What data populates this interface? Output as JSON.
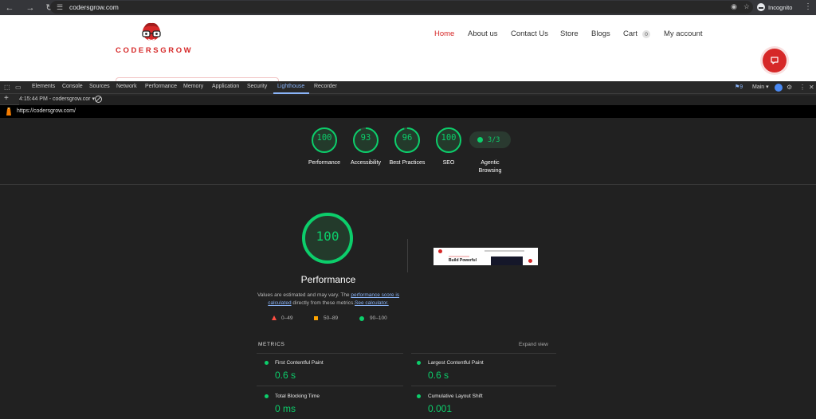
{
  "browser": {
    "url": "codersgrow.com",
    "incognito_label": "Incognito"
  },
  "website": {
    "logo_text": "CODERSGROW",
    "nav": [
      {
        "label": "Home",
        "active": true
      },
      {
        "label": "About us"
      },
      {
        "label": "Contact Us"
      },
      {
        "label": "Store"
      },
      {
        "label": "Blogs"
      },
      {
        "label": "Cart"
      },
      {
        "label": "My account"
      }
    ],
    "cart_count": "0",
    "brand_color": "#d62828"
  },
  "devtools": {
    "tabs": [
      "Elements",
      "Console",
      "Sources",
      "Network",
      "Performance",
      "Memory",
      "Application",
      "Security",
      "Lighthouse",
      "Recorder"
    ],
    "active_tab": "Lighthouse",
    "issues_count": "9",
    "context_label": "Main",
    "report_selector": "4:15:44 PM - codersgrow.cor",
    "accent_color": "#8ab4f8"
  },
  "report": {
    "url": "https://codersgrow.com/",
    "categories": [
      {
        "score": "100",
        "label": "Performance"
      },
      {
        "score": "93",
        "label": "Accessibility"
      },
      {
        "score": "96",
        "label": "Best Practices"
      },
      {
        "score": "100",
        "label": "SEO"
      },
      {
        "score": "3/3",
        "label": "Agentic Browsing"
      }
    ],
    "performance": {
      "score": "100",
      "title": "Performance",
      "note_prefix": "Values are estimated and may vary. The ",
      "note_link1": "performance score is calculated",
      "note_mid": " directly from these metrics.",
      "note_link2": "See calculator."
    },
    "legend": [
      "0–49",
      "50–89",
      "90–100"
    ],
    "metrics_heading": "METRICS",
    "expand_label": "Expand view",
    "metrics": [
      {
        "label": "First Contentful Paint",
        "value": "0.6 s"
      },
      {
        "label": "Largest Contentful Paint",
        "value": "0.6 s"
      },
      {
        "label": "Total Blocking Time",
        "value": "0 ms"
      },
      {
        "label": "Cumulative Layout Shift",
        "value": "0.001"
      }
    ],
    "thumbnail_headline": "Build Powerful",
    "pass_color": "#0cce6b",
    "average_color": "#ffa400",
    "fail_color": "#ff4e42"
  }
}
